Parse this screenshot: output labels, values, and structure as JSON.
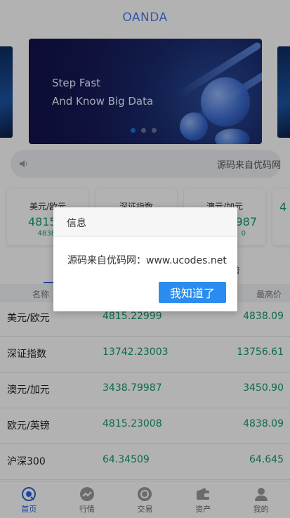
{
  "header": {
    "brand": "OANDA"
  },
  "banner": {
    "line1": "Step Fast",
    "line2": "And Know Big Data",
    "slide_count": 3,
    "active_index": 0
  },
  "notice": {
    "text": "源码来自优码网"
  },
  "quote_cards": [
    {
      "name": "美元/欧元",
      "price": "4815.2",
      "sub": "4838."
    },
    {
      "name": "深证指数",
      "price": "",
      "sub": ""
    },
    {
      "name": "澳元/加元",
      "price": "987",
      "sub": "0"
    },
    {
      "name": "",
      "price": "4",
      "sub": ""
    }
  ],
  "market_tabs": {
    "partial": "普"
  },
  "table": {
    "headers": {
      "name": "名称",
      "high": "最高价"
    },
    "rows": [
      {
        "name": "美元/欧元",
        "last": "4815.22999",
        "high": "4838.09"
      },
      {
        "name": "深证指数",
        "last": "13742.23003",
        "high": "13756.61"
      },
      {
        "name": "澳元/加元",
        "last": "3438.79987",
        "high": "3450.90"
      },
      {
        "name": "欧元/英镑",
        "last": "4815.23008",
        "high": "4838.09"
      },
      {
        "name": "沪深300",
        "last": "64.34509",
        "high": "64.645"
      }
    ]
  },
  "tabbar": [
    {
      "label": "首页",
      "icon": "home-icon",
      "active": true
    },
    {
      "label": "行情",
      "icon": "market-icon",
      "active": false
    },
    {
      "label": "交易",
      "icon": "trade-icon",
      "active": false
    },
    {
      "label": "资产",
      "icon": "wallet-icon",
      "active": false
    },
    {
      "label": "我的",
      "icon": "user-icon",
      "active": false
    }
  ],
  "dialog": {
    "title": "信息",
    "message": "源码来自优码网：www.ucodes.net",
    "confirm_label": "我知道了"
  },
  "colors": {
    "brand": "#4a7ef0",
    "up": "#149a6e",
    "primary_button": "#2b8cf0",
    "active_tab": "#2a64d8"
  }
}
